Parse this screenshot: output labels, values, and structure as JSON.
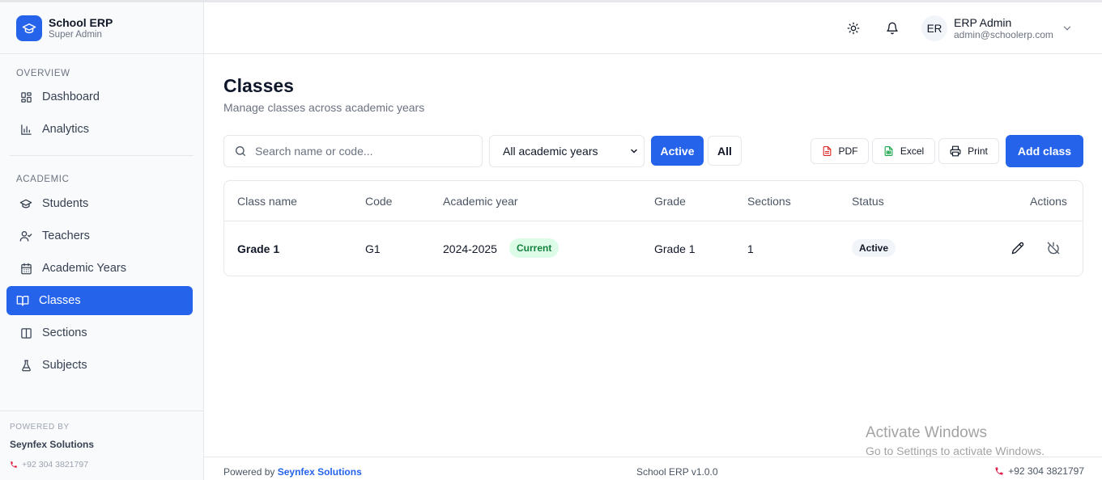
{
  "brand": {
    "title": "School ERP",
    "subtitle": "Super Admin",
    "icon": "graduation-cap-icon"
  },
  "sidebar": {
    "overview_heading": "OVERVIEW",
    "overview_items": [
      {
        "label": "Dashboard",
        "icon": "dashboard-icon"
      },
      {
        "label": "Analytics",
        "icon": "bar-chart-icon"
      }
    ],
    "academic_heading": "ACADEMIC",
    "academic_items": [
      {
        "label": "Students",
        "icon": "graduation-cap-icon"
      },
      {
        "label": "Teachers",
        "icon": "user-check-icon"
      },
      {
        "label": "Academic Years",
        "icon": "calendar-icon"
      },
      {
        "label": "Classes",
        "icon": "book-open-icon",
        "active": true
      },
      {
        "label": "Sections",
        "icon": "columns-icon"
      },
      {
        "label": "Subjects",
        "icon": "flask-icon"
      }
    ],
    "powered_label": "POWERED BY",
    "powered_name": "Seynfex Solutions",
    "phone": "+92 304 3821797"
  },
  "header": {
    "user_initials": "ER",
    "user_name": "ERP Admin",
    "user_email": "admin@schoolerp.com"
  },
  "page": {
    "title": "Classes",
    "subtitle": "Manage classes across academic years"
  },
  "toolbar": {
    "search_placeholder": "Search name or code...",
    "year_select": "All academic years",
    "filter_active": "Active",
    "filter_all": "All",
    "pdf": "PDF",
    "excel": "Excel",
    "print": "Print",
    "add": "Add class"
  },
  "table": {
    "columns": [
      "Class name",
      "Code",
      "Academic year",
      "Grade",
      "Sections",
      "Status",
      "Actions"
    ],
    "rows": [
      {
        "class_name": "Grade 1",
        "code": "G1",
        "academic_year": "2024-2025",
        "year_badge": "Current",
        "grade": "Grade 1",
        "sections": "1",
        "status": "Active"
      }
    ]
  },
  "watermark": {
    "title": "Activate Windows",
    "subtitle": "Go to Settings to activate Windows."
  },
  "footer": {
    "powered_prefix": "Powered by",
    "powered_link": "Seynfex Solutions",
    "version": "School ERP v1.0.0",
    "phone": "+92 304 3821797"
  },
  "colors": {
    "accent": "#2563eb",
    "current_badge_bg": "#dcfce7",
    "current_badge_text": "#15803d",
    "pdf_icon": "#dc2626",
    "excel_icon": "#16a34a",
    "phone_icon": "#e11d48"
  }
}
